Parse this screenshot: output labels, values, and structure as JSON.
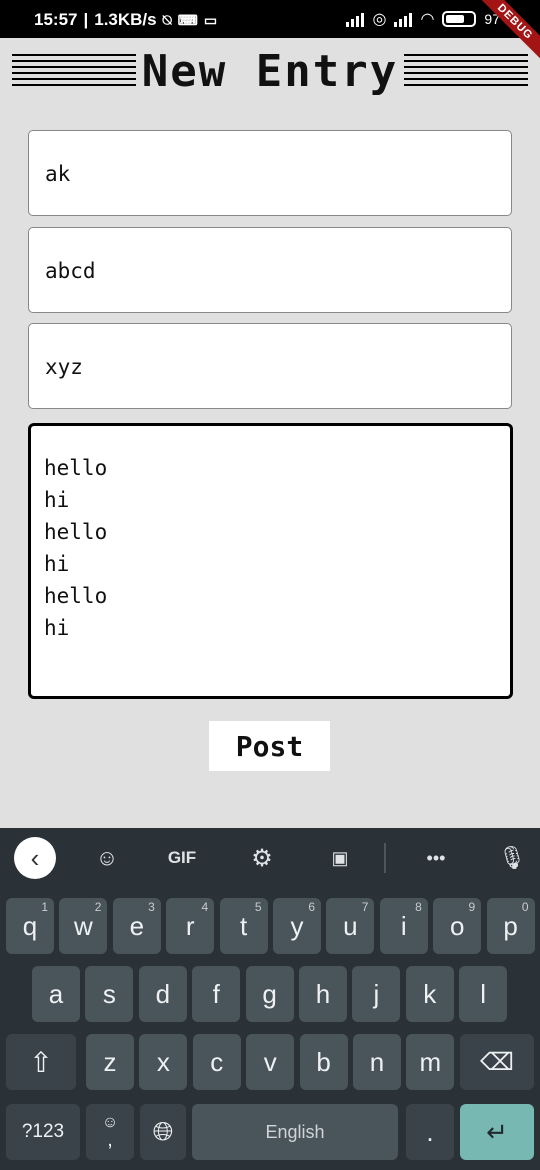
{
  "status": {
    "time": "15:57",
    "speed": "1.3KB/s",
    "battery_pct": "97"
  },
  "debug_label": "DEBUG",
  "page_title": "New Entry",
  "fields": [
    {
      "value": "ak"
    },
    {
      "value": "abcd"
    },
    {
      "value": "xyz"
    }
  ],
  "body_text": "hello\nhi\nhello\nhi\nhello\nhi",
  "post_label": "Post",
  "keyboard": {
    "toolbar": {
      "gif": "GIF",
      "more": "•••"
    },
    "row1": [
      {
        "k": "q",
        "h": "1"
      },
      {
        "k": "w",
        "h": "2"
      },
      {
        "k": "e",
        "h": "3"
      },
      {
        "k": "r",
        "h": "4"
      },
      {
        "k": "t",
        "h": "5"
      },
      {
        "k": "y",
        "h": "6"
      },
      {
        "k": "u",
        "h": "7"
      },
      {
        "k": "i",
        "h": "8"
      },
      {
        "k": "o",
        "h": "9"
      },
      {
        "k": "p",
        "h": "0"
      }
    ],
    "row2": [
      "a",
      "s",
      "d",
      "f",
      "g",
      "h",
      "j",
      "k",
      "l"
    ],
    "row3": [
      "z",
      "x",
      "c",
      "v",
      "b",
      "n",
      "m"
    ],
    "symbols_label": "?123",
    "comma_label": ",",
    "space_label": "English",
    "period_label": "."
  }
}
